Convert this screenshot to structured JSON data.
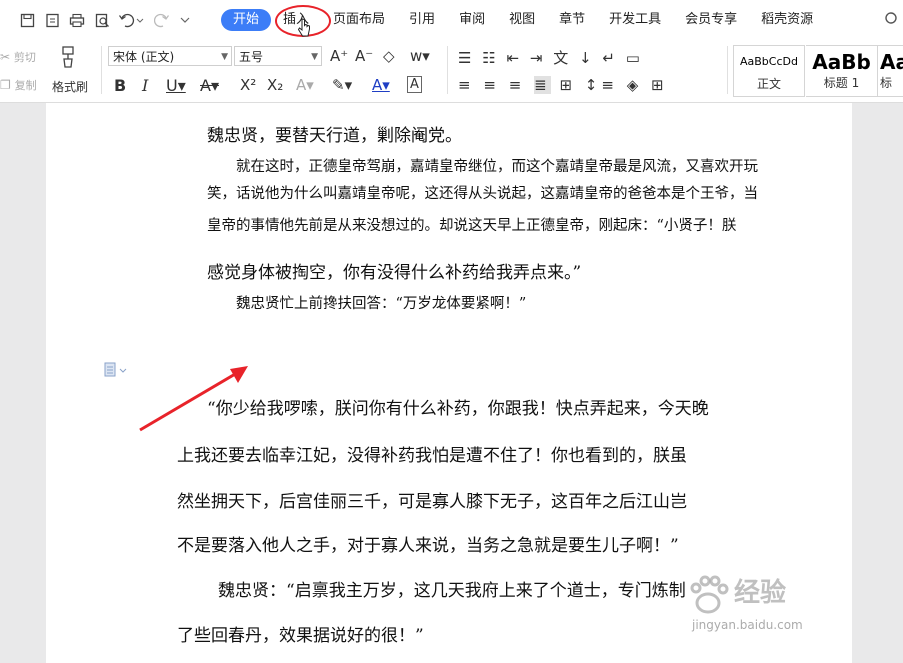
{
  "menubar": {
    "tabs": [
      {
        "label": "开始"
      },
      {
        "label": "插入"
      },
      {
        "label": "页面布局"
      },
      {
        "label": "引用"
      },
      {
        "label": "审阅"
      },
      {
        "label": "视图"
      },
      {
        "label": "章节"
      },
      {
        "label": "开发工具"
      },
      {
        "label": "会员专享"
      },
      {
        "label": "稻壳资源"
      }
    ]
  },
  "ribbon": {
    "cut_label": "剪切",
    "copy_label": "复制",
    "format_painter_label": "格式刷",
    "font_name": "宋体 (正文)",
    "font_size": "五号",
    "styles": [
      {
        "preview": "AaBbCcDd",
        "label": "正文"
      },
      {
        "preview": "AaBb",
        "label": "标题 1"
      },
      {
        "preview": "Aa",
        "label": "标"
      }
    ]
  },
  "document": {
    "lines": [
      "魏忠贤，要替天行道，剿除阉党。",
      "就在这时，正德皇帝驾崩，嘉靖皇帝继位，而这个嘉靖皇帝最是风流，又喜欢开玩",
      "笑，话说他为什么叫嘉靖皇帝呢，这还得从头说起，这嘉靖皇帝的爸爸本是个王爷，当",
      "皇帝的事情他先前是从来没想过的。却说这天早上正德皇帝，刚起床：“小贤子！朕",
      "感觉身体被掏空，你有没得什么补药给我弄点来。”",
      "魏忠贤忙上前搀扶回答：“万岁龙体要紧啊！”",
      "“你少给我啰嗦，朕问你有什么补药，你跟我！快点弄起来，今天晚",
      "上我还要去临幸江妃，没得补药我怕是遭不住了！你也看到的，朕虽",
      "然坐拥天下，后宫佳丽三千，可是寡人膝下无子，这百年之后江山岂",
      "不是要落入他人之手，对于寡人来说，当务之急就是要生儿子啊！”",
      "魏忠贤：“启禀我主万岁，这几天我府上来了个道士，专门炼制",
      "了些回春丹，效果据说好的很！”"
    ]
  },
  "watermark": {
    "text": "经验",
    "url": "jingyan.baidu.com"
  }
}
